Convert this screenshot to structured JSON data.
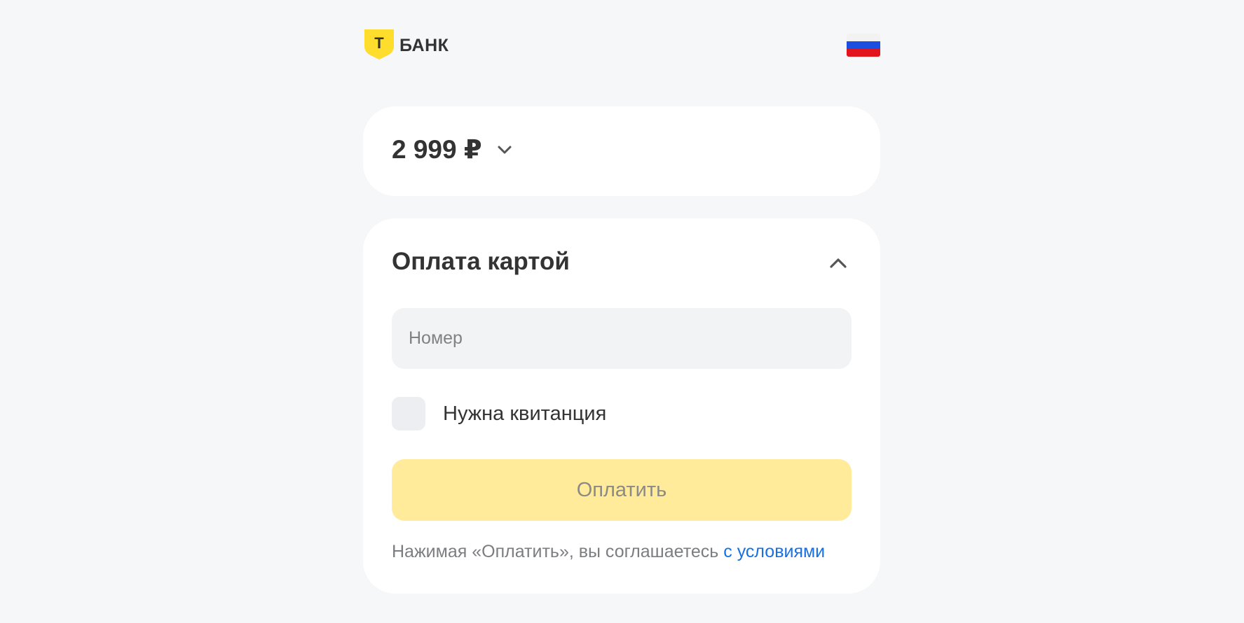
{
  "header": {
    "brand_name": "БАНК",
    "brand_letter": "Т",
    "language": "Русский",
    "flag_colors": [
      "#f2f2f2",
      "#1a4fe0",
      "#e2141c"
    ]
  },
  "amount": {
    "value": "2 999 ₽"
  },
  "payment": {
    "title": "Оплата картой",
    "card_number_placeholder": "Номер",
    "card_number_value": "",
    "receipt_label": "Нужна квитанция",
    "receipt_checked": false,
    "pay_button_label": "Оплатить",
    "terms_text": "Нажимая «Оплатить», вы соглашаетесь",
    "terms_link": "с условиями"
  },
  "colors": {
    "brand_yellow": "#ffdd2d",
    "pay_button_disabled": "#ffeb99",
    "link_blue": "#1870e5",
    "background": "#f6f7f8"
  },
  "icons": {
    "amount_toggle": "chevron-down-icon",
    "section_toggle": "chevron-up-icon",
    "logo": "shield-logo-icon"
  }
}
